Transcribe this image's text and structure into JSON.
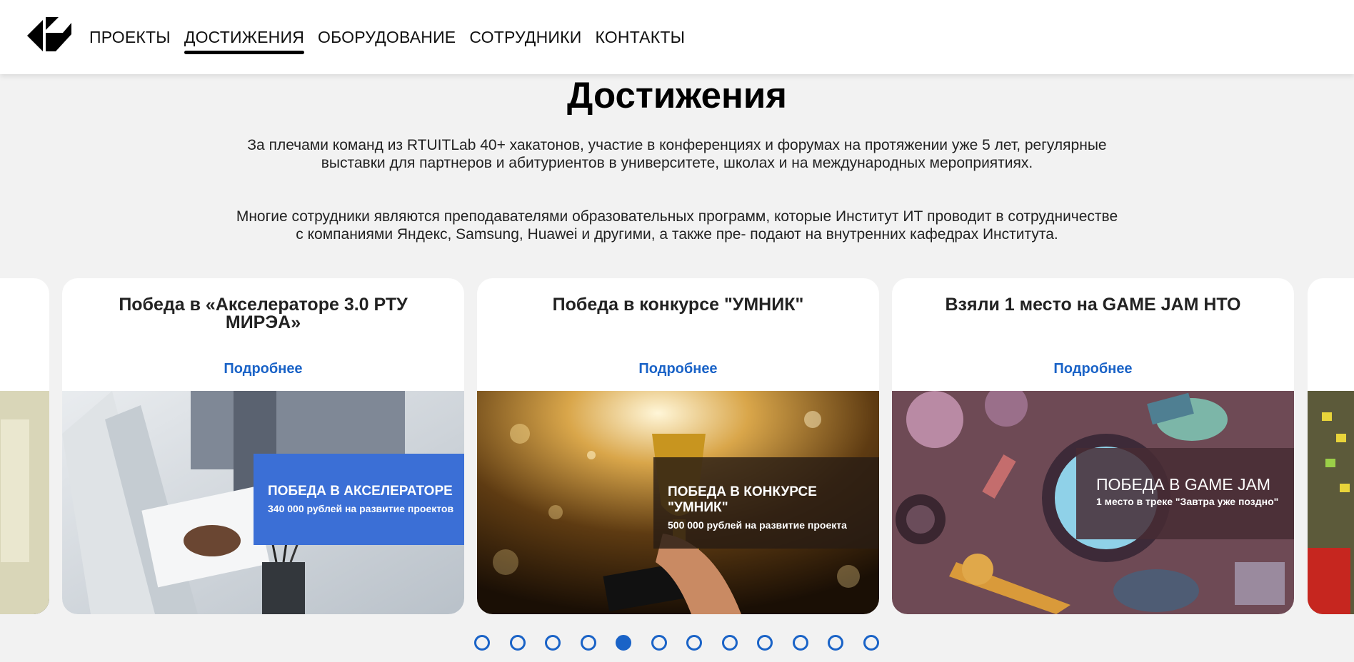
{
  "nav": {
    "items": [
      {
        "label": "ПРОЕКТЫ",
        "active": false
      },
      {
        "label": "ДОСТИЖЕНИЯ",
        "active": true
      },
      {
        "label": "ОБОРУДОВАНИЕ",
        "active": false
      },
      {
        "label": "СОТРУДНИКИ",
        "active": false
      },
      {
        "label": "КОНТАКТЫ",
        "active": false
      }
    ]
  },
  "main": {
    "title": "Достижения",
    "paragraph1": "За плечами команд из RTUITLab 40+ хакатонов, участие в конференциях и форумах на протяжении уже 5 лет, регулярные выставки для партнеров и абитуриентов в университете, школах и на международных мероприятиях.",
    "paragraph2": "Многие сотрудники являются преподавателями образовательных программ, которые Институт ИТ проводит в сотрудничестве с компаниями Яндекс, Samsung, Huawei и другими, а также пре- подают на внутренних кафедрах Института."
  },
  "cards": [
    {
      "title": "Победа в «Акселераторе 3.0 РТУ МИРЭА»",
      "more": "Подробнее",
      "banner_title": "ПОБЕДА В АКСЕЛЕРАТОРЕ",
      "banner_sub": "340 000 рублей на развитие проектов",
      "banner_color": "#3b6fd6"
    },
    {
      "title": "Победа в конкурсе \"УМНИК\"",
      "more": "Подробнее",
      "banner_title": "ПОБЕДА В КОНКУРСЕ \"УМНИК\"",
      "banner_sub": "500 000 рублей на развитие проекта",
      "banner_color": "#3a2a1c"
    },
    {
      "title": "Взяли 1 место на GAME JAM НТО",
      "more": "Подробнее",
      "banner_title": "ПОБЕДА В GAME JAM",
      "banner_sub": "1 место в треке \"Завтра уже поздно\"",
      "banner_color": "#4a3035"
    }
  ],
  "pagination": {
    "count": 12,
    "active_index": 4
  },
  "colors": {
    "accent": "#1a63c7",
    "background": "#f2f2f2"
  }
}
